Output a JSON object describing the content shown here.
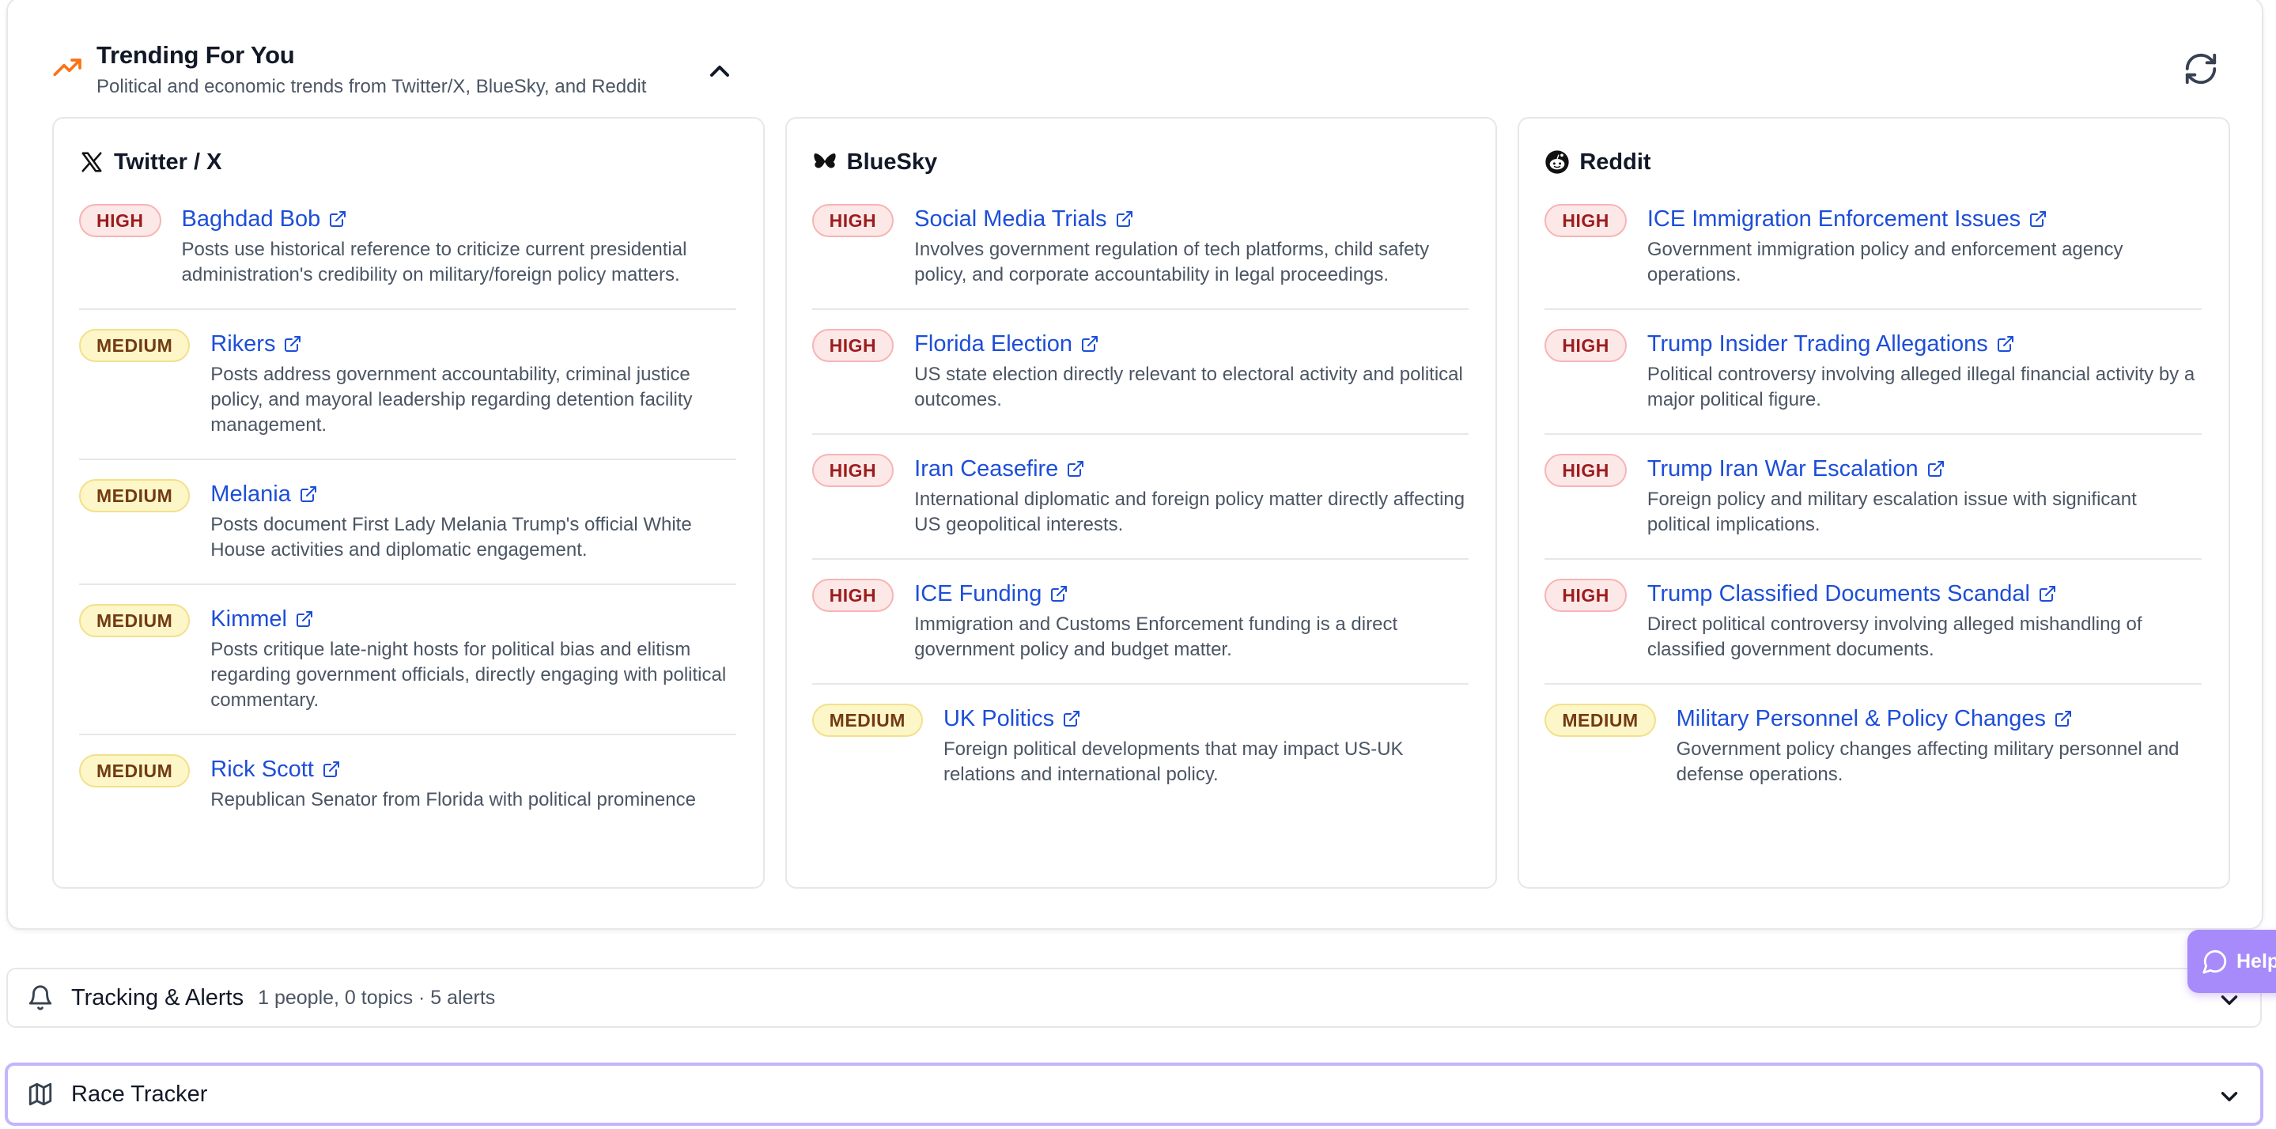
{
  "trending": {
    "title": "Trending For You",
    "subtitle": "Political and economic trends from Twitter/X, BlueSky, and Reddit",
    "accent_color": "#f97316",
    "columns": [
      {
        "platform": "Twitter / X",
        "icon": "x-logo-icon",
        "items": [
          {
            "priority": "HIGH",
            "title": "Baghdad Bob",
            "description": "Posts use historical reference to criticize current presidential administration's credibility on military/foreign policy matters."
          },
          {
            "priority": "MEDIUM",
            "title": "Rikers",
            "description": "Posts address government accountability, criminal justice policy, and mayoral leadership regarding detention facility management."
          },
          {
            "priority": "MEDIUM",
            "title": "Melania",
            "description": "Posts document First Lady Melania Trump's official White House activities and diplomatic engagement."
          },
          {
            "priority": "MEDIUM",
            "title": "Kimmel",
            "description": "Posts critique late-night hosts for political bias and elitism regarding government officials, directly engaging with political commentary."
          },
          {
            "priority": "MEDIUM",
            "title": "Rick Scott",
            "description": "Republican Senator from Florida with political prominence"
          }
        ]
      },
      {
        "platform": "BlueSky",
        "icon": "butterfly-icon",
        "items": [
          {
            "priority": "HIGH",
            "title": "Social Media Trials",
            "description": "Involves government regulation of tech platforms, child safety policy, and corporate accountability in legal proceedings."
          },
          {
            "priority": "HIGH",
            "title": "Florida Election",
            "description": "US state election directly relevant to electoral activity and political outcomes."
          },
          {
            "priority": "HIGH",
            "title": "Iran Ceasefire",
            "description": "International diplomatic and foreign policy matter directly affecting US geopolitical interests."
          },
          {
            "priority": "HIGH",
            "title": "ICE Funding",
            "description": "Immigration and Customs Enforcement funding is a direct government policy and budget matter."
          },
          {
            "priority": "MEDIUM",
            "title": "UK Politics",
            "description": "Foreign political developments that may impact US-UK relations and international policy."
          }
        ]
      },
      {
        "platform": "Reddit",
        "icon": "reddit-logo-icon",
        "items": [
          {
            "priority": "HIGH",
            "title": "ICE Immigration Enforcement Issues",
            "description": "Government immigration policy and enforcement agency operations."
          },
          {
            "priority": "HIGH",
            "title": "Trump Insider Trading Allegations",
            "description": "Political controversy involving alleged illegal financial activity by a major political figure."
          },
          {
            "priority": "HIGH",
            "title": "Trump Iran War Escalation",
            "description": "Foreign policy and military escalation issue with significant political implications."
          },
          {
            "priority": "HIGH",
            "title": "Trump Classified Documents Scandal",
            "description": "Direct political controversy involving alleged mishandling of classified government documents."
          },
          {
            "priority": "MEDIUM",
            "title": "Military Personnel & Policy Changes",
            "description": "Government policy changes affecting military personnel and defense operations."
          }
        ]
      }
    ]
  },
  "tracking": {
    "title": "Tracking & Alerts",
    "meta": "1 people, 0 topics · 5 alerts"
  },
  "race": {
    "title": "Race Tracker"
  },
  "help": {
    "label": "Help"
  }
}
